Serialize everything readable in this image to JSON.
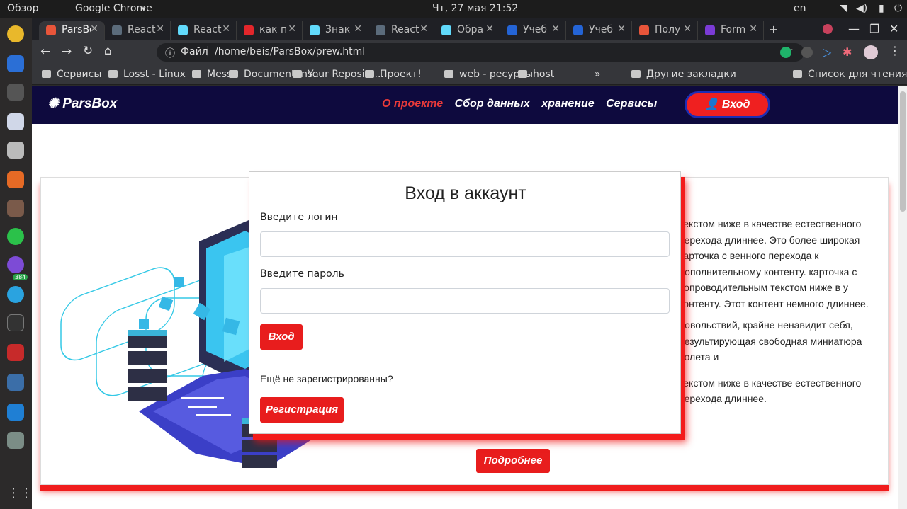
{
  "os": {
    "activities": "Обзор",
    "app": "Google Chrome",
    "clock": "Чт, 27 мая  21:52",
    "lang": "en",
    "badge": "384"
  },
  "tabs": [
    {
      "title": "ParsBox",
      "color": "#e8553a"
    },
    {
      "title": "React",
      "color": "#5b6b7b"
    },
    {
      "title": "React",
      "color": "#61dafb"
    },
    {
      "title": "как п",
      "color": "#e3262b"
    },
    {
      "title": "Знак",
      "color": "#61dafb"
    },
    {
      "title": "React",
      "color": "#5b6b7b"
    },
    {
      "title": "Обра",
      "color": "#61dafb"
    },
    {
      "title": "Учеб",
      "color": "#2464d6"
    },
    {
      "title": "Учеб",
      "color": "#2464d6"
    },
    {
      "title": "Полу",
      "color": "#e8553a"
    },
    {
      "title": "Form",
      "color": "#7b3bd6"
    }
  ],
  "address": {
    "prefix": "Файл",
    "url": "/home/beis/ParsBox/prew.html"
  },
  "bookmarks": [
    "Сервисы",
    "Losst - Linux",
    "Mess",
    "Documentans...",
    "Your Reposito...",
    "Проект!",
    "web - ресурсы",
    "host",
    "»",
    "Другие закладки",
    "Список для чтения"
  ],
  "site": {
    "brand": "ParsBox",
    "nav": [
      "О проекте",
      "Сбор данных",
      "хранение",
      "Сервисы"
    ],
    "login": "Вход",
    "card_text": [
      "текстом ниже в качестве естественного перехода длиннее. Это более широкая карточка с венного перехода к дополнительному контенту. карточка с сопроводительным текстом ниже в у контенту. Этот контент немного длиннее.",
      "довольствий, крайне ненавидит себя, результирующая свободная миниатюра полета и",
      "текстом ниже в качестве естественного перехода длиннее."
    ],
    "more": "Подробнее"
  },
  "modal": {
    "title": "Вход в аккаунт",
    "login_label": "Введите логин",
    "password_label": "Введите пароль",
    "submit": "Вход",
    "question": "Ещё не зарегистрированны?",
    "register": "Регистрация"
  }
}
